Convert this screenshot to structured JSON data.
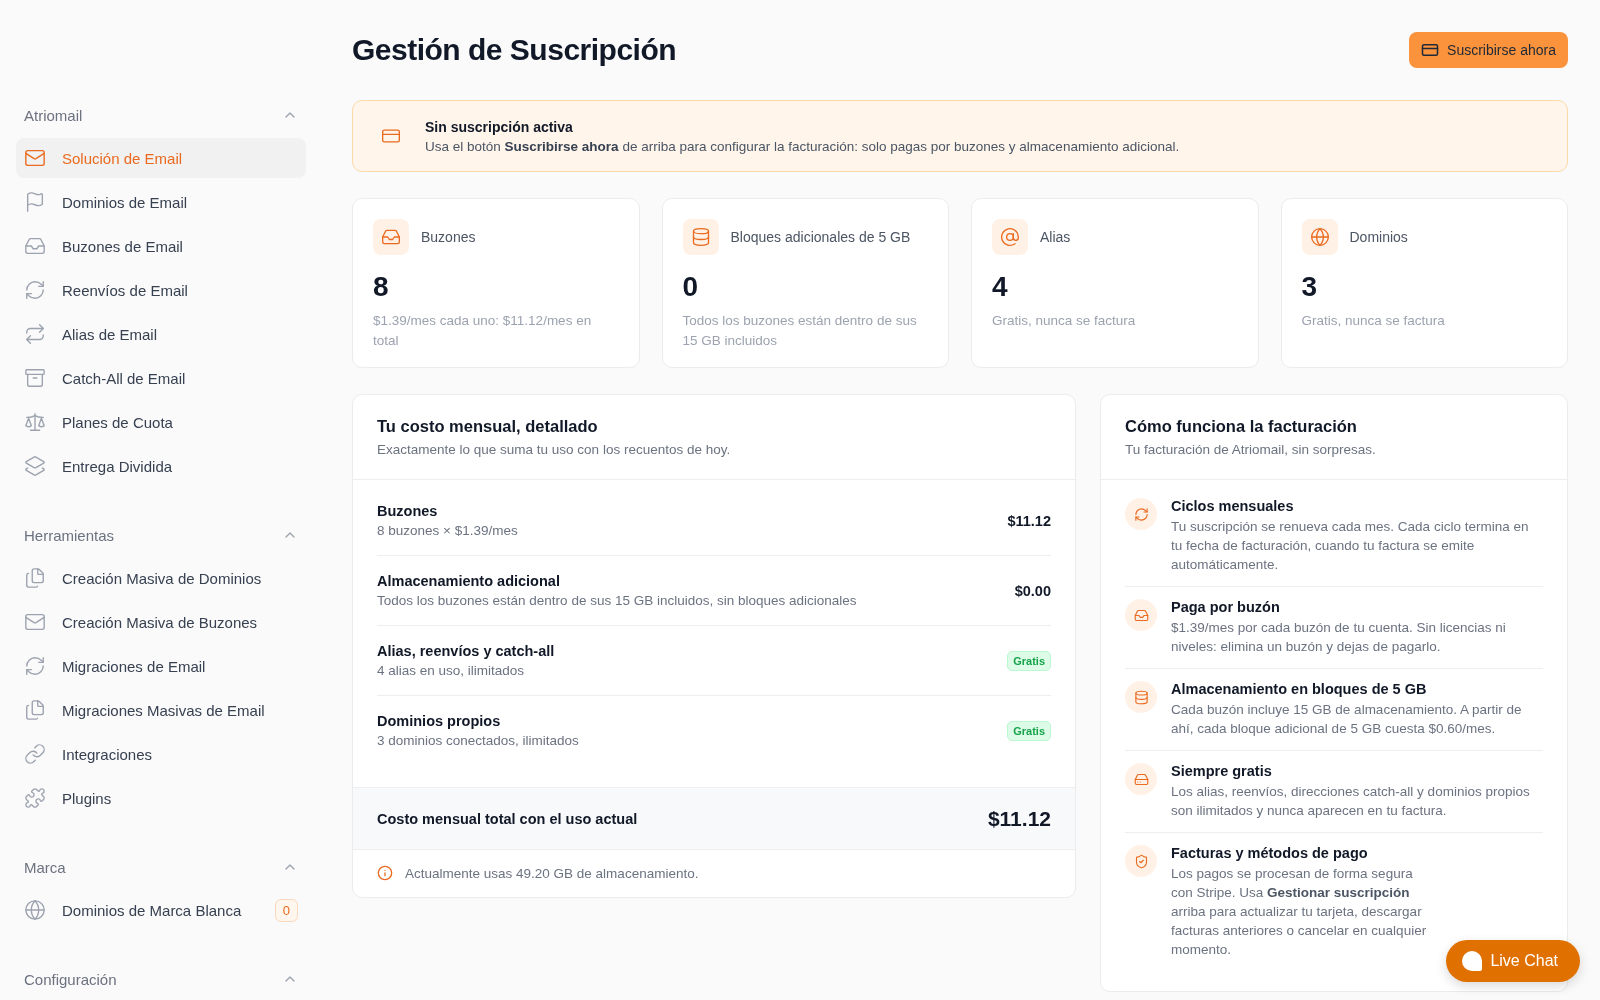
{
  "sidebar": {
    "sections": [
      {
        "title": "Atriomail",
        "expanded": true,
        "items": [
          {
            "label": "Solución de Email",
            "selected": true
          },
          {
            "label": "Dominios de Email",
            "selected": false
          },
          {
            "label": "Buzones de Email",
            "selected": false
          },
          {
            "label": "Reenvíos de Email",
            "selected": false
          },
          {
            "label": "Alias de Email",
            "selected": false
          },
          {
            "label": "Catch-All de Email",
            "selected": false
          },
          {
            "label": "Planes de Cuota",
            "selected": false
          },
          {
            "label": "Entrega Dividida",
            "selected": false
          }
        ]
      },
      {
        "title": "Herramientas",
        "expanded": true,
        "items": [
          {
            "label": "Creación Masiva de Dominios",
            "selected": false
          },
          {
            "label": "Creación Masiva de Buzones",
            "selected": false
          },
          {
            "label": "Migraciones de Email",
            "selected": false
          },
          {
            "label": "Migraciones Masivas de Email",
            "selected": false
          },
          {
            "label": "Integraciones",
            "selected": false
          },
          {
            "label": "Plugins",
            "selected": false
          }
        ]
      },
      {
        "title": "Marca",
        "expanded": true,
        "items": [
          {
            "label": "Dominios de Marca Blanca",
            "selected": false,
            "badge": "0"
          }
        ]
      },
      {
        "title": "Configuración",
        "expanded": true
      }
    ]
  },
  "header": {
    "title": "Gestión de Suscripción",
    "button": "Suscribirse ahora"
  },
  "notice": {
    "title": "Sin suscripción activa",
    "text": "Usa el botón **Suscribirse ahora** de arriba para configurar la facturación: solo pagas por buzones y almacenamiento adicional."
  },
  "stats": [
    {
      "label": "Buzones",
      "value": "8",
      "note": "$1.39/mes cada uno: $11.12/mes en total"
    },
    {
      "label": "Bloques adicionales de 5 GB",
      "value": "0",
      "note": "Todos los buzones están dentro de sus 15 GB incluidos"
    },
    {
      "label": "Alias",
      "value": "4",
      "note": "Gratis, nunca se factura"
    },
    {
      "label": "Dominios",
      "value": "3",
      "note": "Gratis, nunca se factura"
    }
  ],
  "breakdown": {
    "title": "Tu costo mensual, detallado",
    "subtitle": "Exactamente lo que suma tu uso con los recuentos de hoy.",
    "rows": [
      {
        "title": "Buzones",
        "detail": "8 buzones × $1.39/mes",
        "kind": "amount",
        "value": "$11.12"
      },
      {
        "title": "Almacenamiento adicional",
        "detail": "Todos los buzones están dentro de sus 15 GB incluidos, sin bloques adicionales",
        "kind": "amount",
        "value": "$0.00"
      },
      {
        "title": "Alias, reenvíos y catch-all",
        "detail": "4 alias en uso, ilimitados",
        "kind": "badge",
        "value": "Gratis"
      },
      {
        "title": "Dominios propios",
        "detail": "3 dominios conectados, ilimitados",
        "kind": "badge",
        "value": "Gratis"
      }
    ],
    "total": {
      "label": "Costo mensual total con el uso actual",
      "value": "$11.12"
    },
    "note": "Actualmente usas 49.20 GB de almacenamiento."
  },
  "billing": {
    "title": "Cómo funciona la facturación",
    "subtitle": "Tu facturación de Atriomail, sin sorpresas.",
    "items": [
      {
        "title": "Ciclos mensuales",
        "text": "Tu suscripción se renueva cada mes. Cada ciclo termina en tu fecha de facturación, cuando tu factura se emite automáticamente."
      },
      {
        "title": "Paga por buzón",
        "text": "$1.39/mes por cada buzón de tu cuenta. Sin licencias ni niveles: elimina un buzón y dejas de pagarlo."
      },
      {
        "title": "Almacenamiento en bloques de 5 GB",
        "text": "Cada buzón incluye 15 GB de almacenamiento. A partir de ahí, cada bloque adicional de 5 GB cuesta $0.60/mes."
      },
      {
        "title": "Siempre gratis",
        "text": "Los alias, reenvíos, direcciones catch-all y dominios propios son ilimitados y nunca aparecen en tu factura."
      },
      {
        "title": "Facturas y métodos de pago",
        "text": "Los pagos se procesan de forma segura con Stripe. Usa **Gestionar suscripción** arriba para actualizar tu tarjeta, descargar facturas anteriores o cancelar en cualquier momento."
      }
    ]
  },
  "live_chat": {
    "label": "Live Chat"
  }
}
